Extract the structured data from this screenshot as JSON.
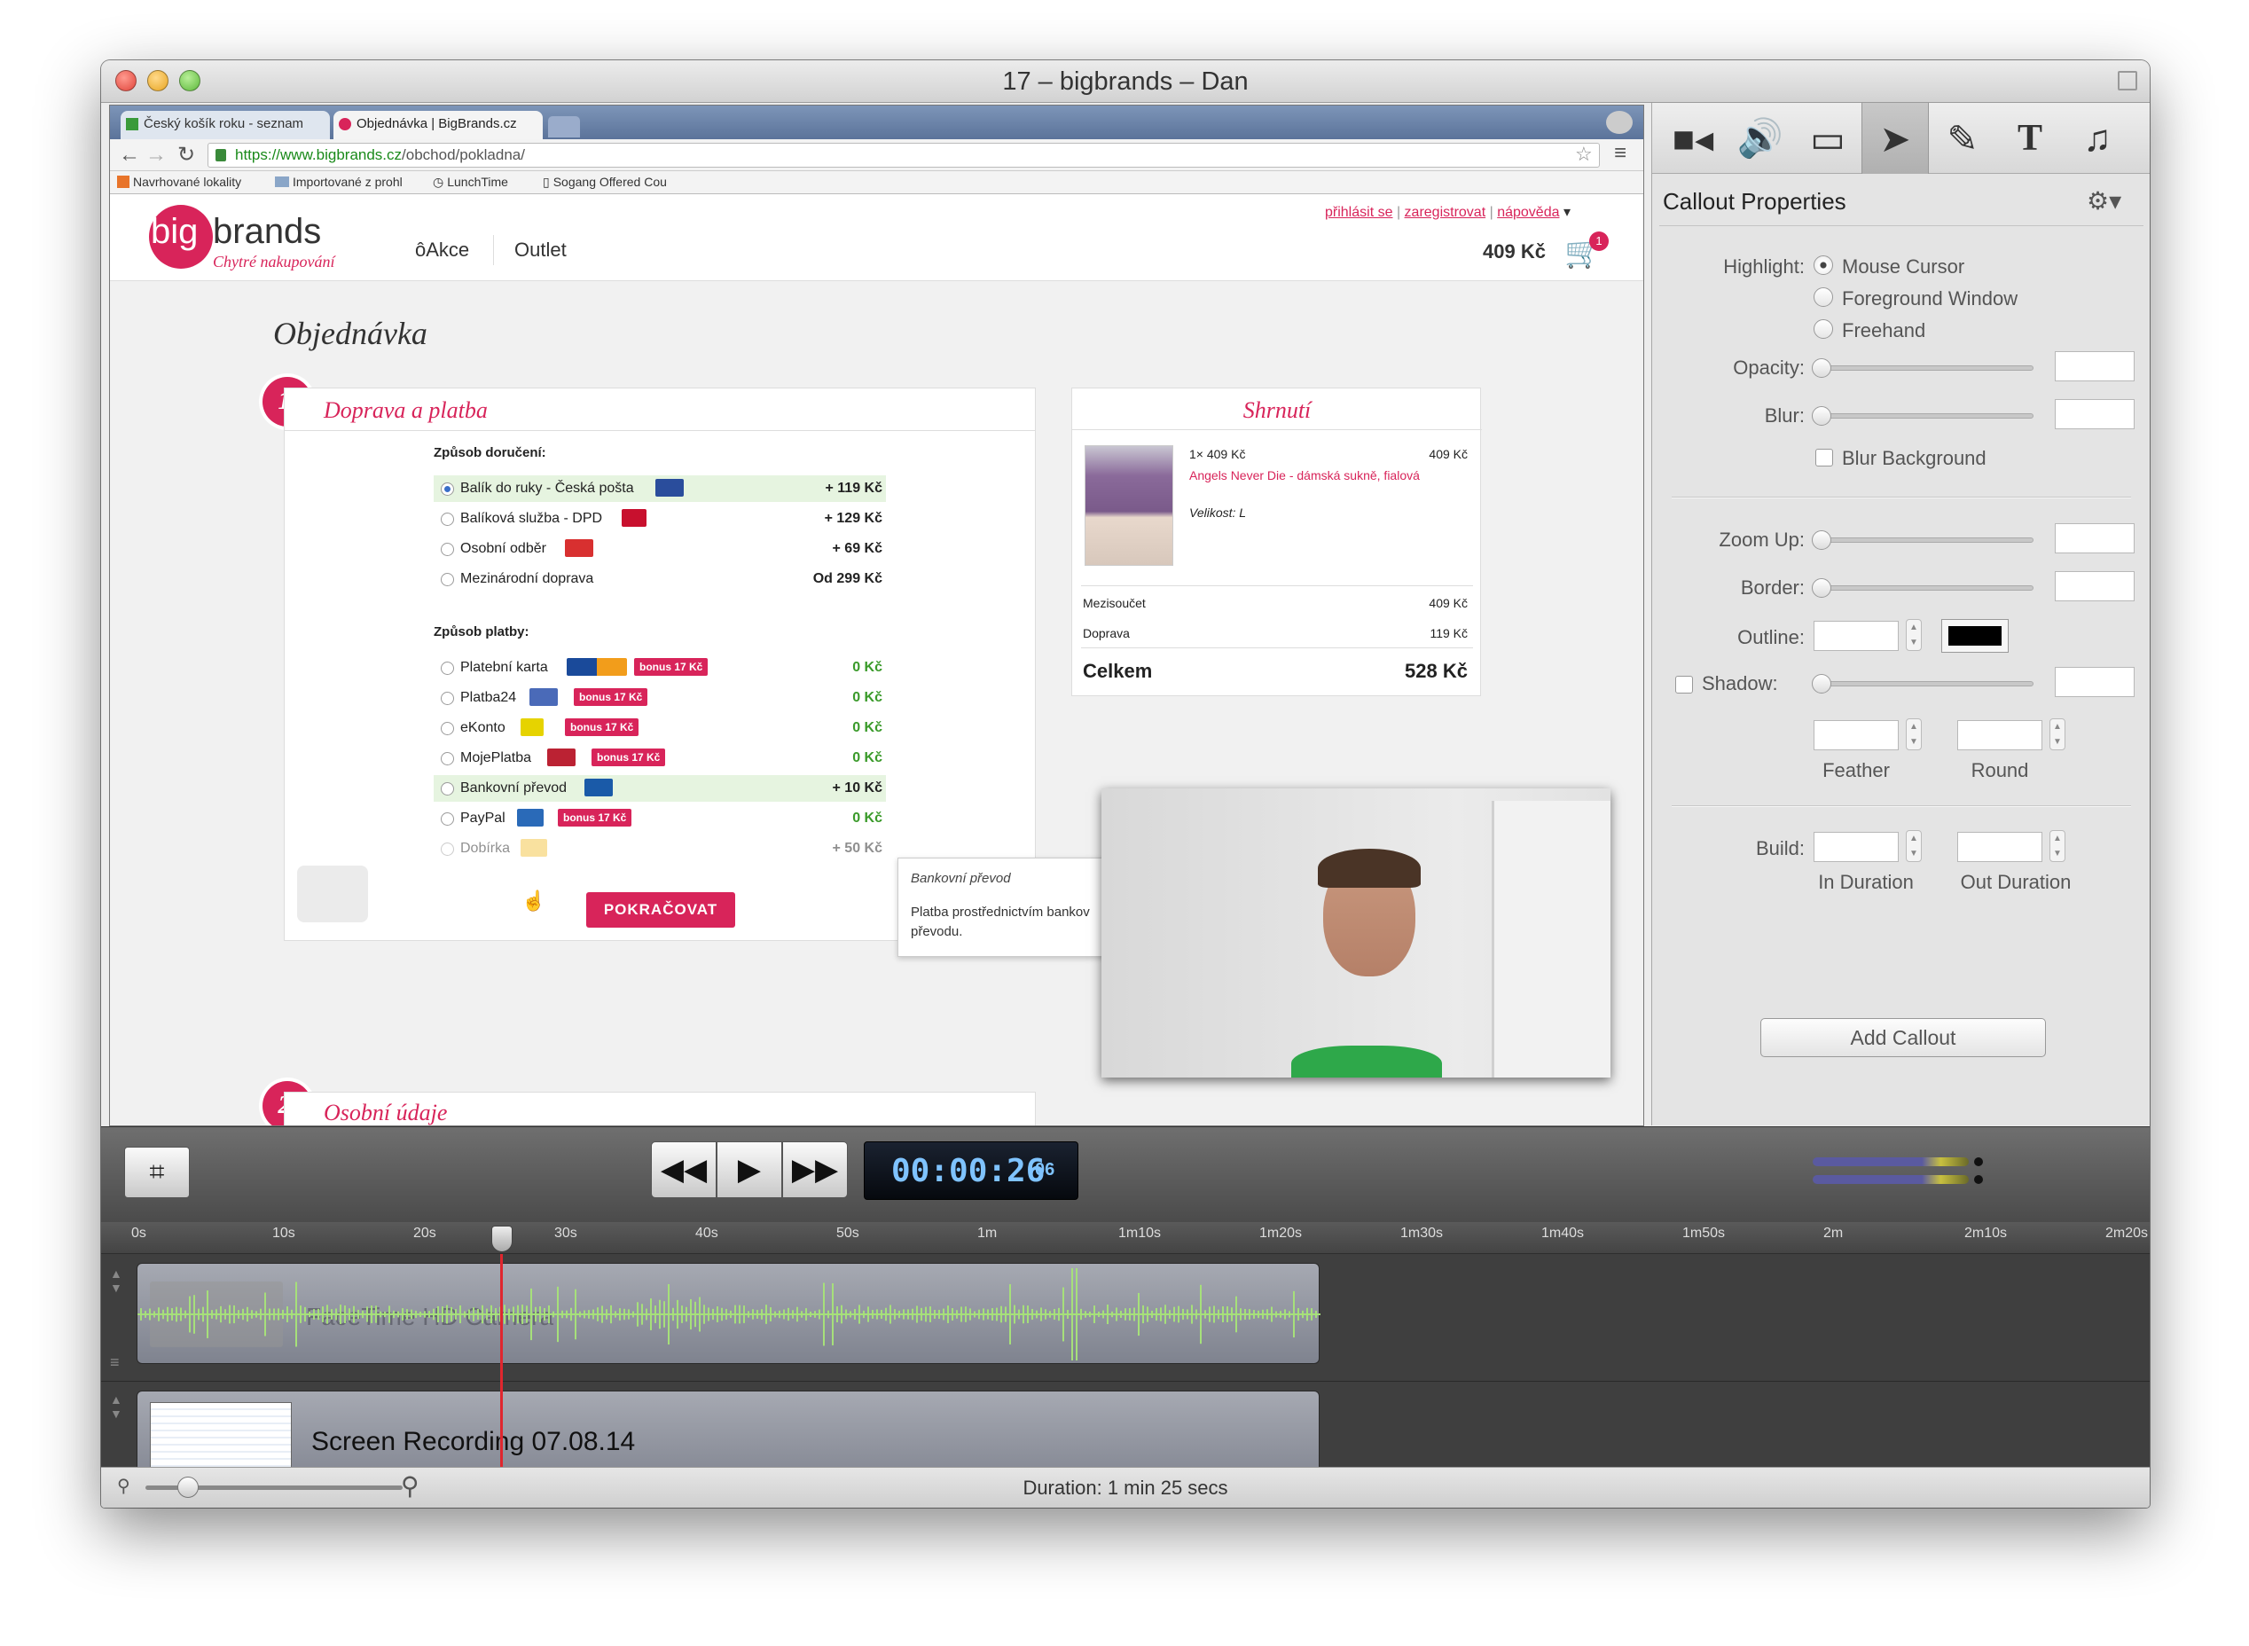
{
  "window": {
    "title": "17 – bigbrands – Dan"
  },
  "browser": {
    "tabs": [
      {
        "label": "Český košík roku - seznam"
      },
      {
        "label": "Objednávka | BigBrands.cz"
      }
    ],
    "url_host": "https://www.bigbrands.cz",
    "url_path": "/obchod/pokladna/",
    "bookmarks": [
      "Navrhované lokality",
      "Importované z prohl",
      "LunchTime",
      "Sogang Offered Cou"
    ]
  },
  "site": {
    "logo_big": "big",
    "logo_brands": "brands",
    "logo_tagline": "Chytré nakupování",
    "nav": [
      "Akce",
      "Outlet"
    ],
    "top_links": [
      "přihlásit se",
      "zaregistrovat",
      "nápověda"
    ],
    "cart_total": "409 Kč",
    "cart_count": "1",
    "page_title": "Objednávka",
    "step1_num": "1.",
    "step1_title": "Doprava a platba",
    "step2_num": "2.",
    "step2_title": "Osobní údaje",
    "delivery_heading": "Způsob doručení:",
    "delivery": [
      {
        "label": "Balík do ruky - Česká pošta",
        "price": "+ 119 Kč"
      },
      {
        "label": "Balíková služba - DPD",
        "price": "+ 129 Kč"
      },
      {
        "label": "Osobní odběr",
        "price": "+ 69 Kč"
      },
      {
        "label": "Mezinárodní doprava",
        "price": "Od 299 Kč"
      }
    ],
    "payment_heading": "Způsob platby:",
    "payment": [
      {
        "label": "Platební karta",
        "bonus": "bonus 17 Kč",
        "price": "0 Kč"
      },
      {
        "label": "Platba24",
        "bonus": "bonus 17 Kč",
        "price": "0 Kč"
      },
      {
        "label": "eKonto",
        "bonus": "bonus 17 Kč",
        "price": "0 Kč"
      },
      {
        "label": "MojePlatba",
        "bonus": "bonus 17 Kč",
        "price": "0 Kč"
      },
      {
        "label": "Bankovní převod",
        "bonus": "",
        "price": "+ 10 Kč"
      },
      {
        "label": "PayPal",
        "bonus": "bonus 17 Kč",
        "price": "0 Kč"
      },
      {
        "label": "Dobírka",
        "bonus": "",
        "price": "+ 50 Kč"
      }
    ],
    "continue_button": "POKRAČOVAT",
    "tooltip_title": "Bankovní převod",
    "tooltip_text": "Platba prostřednictvím bankov převodu.",
    "summary_title": "Shrnutí",
    "summary_qty": "1× 409 Kč",
    "summary_price": "409 Kč",
    "summary_product": "Angels Never Die - dámská sukně, fialová",
    "summary_size": "Velikost: L",
    "subtotal_label": "Mezisoučet",
    "subtotal_value": "409 Kč",
    "shipping_label": "Doprava",
    "shipping_value": "119 Kč",
    "total_label": "Celkem",
    "total_value": "528 Kč"
  },
  "callout": {
    "title": "Callout Properties",
    "highlight_label": "Highlight:",
    "highlight_options": [
      "Mouse Cursor",
      "Foreground Window",
      "Freehand"
    ],
    "highlight_selected": "Mouse Cursor",
    "opacity_label": "Opacity:",
    "blur_label": "Blur:",
    "blur_background": "Blur Background",
    "zoom_label": "Zoom Up:",
    "border_label": "Border:",
    "outline_label": "Outline:",
    "outline_color": "#000000",
    "shadow_label": "Shadow:",
    "feather_label": "Feather",
    "round_label": "Round",
    "build_label": "Build:",
    "in_duration": "In Duration",
    "out_duration": "Out Duration",
    "add_button": "Add Callout"
  },
  "transport": {
    "timecode_main": "00:00:26",
    "timecode_frames": "06"
  },
  "timeline": {
    "ticks": [
      "0s",
      "10s",
      "20s",
      "30s",
      "40s",
      "50s",
      "1m",
      "1m10s",
      "1m20s",
      "1m30s",
      "1m40s",
      "1m50s",
      "2m",
      "2m10s",
      "2m20s"
    ],
    "audio_clip_label": "FaceTime HD Camera",
    "screen_clip_label": "Screen Recording 07.08.14",
    "duration": "Duration: 1 min 25 secs"
  }
}
